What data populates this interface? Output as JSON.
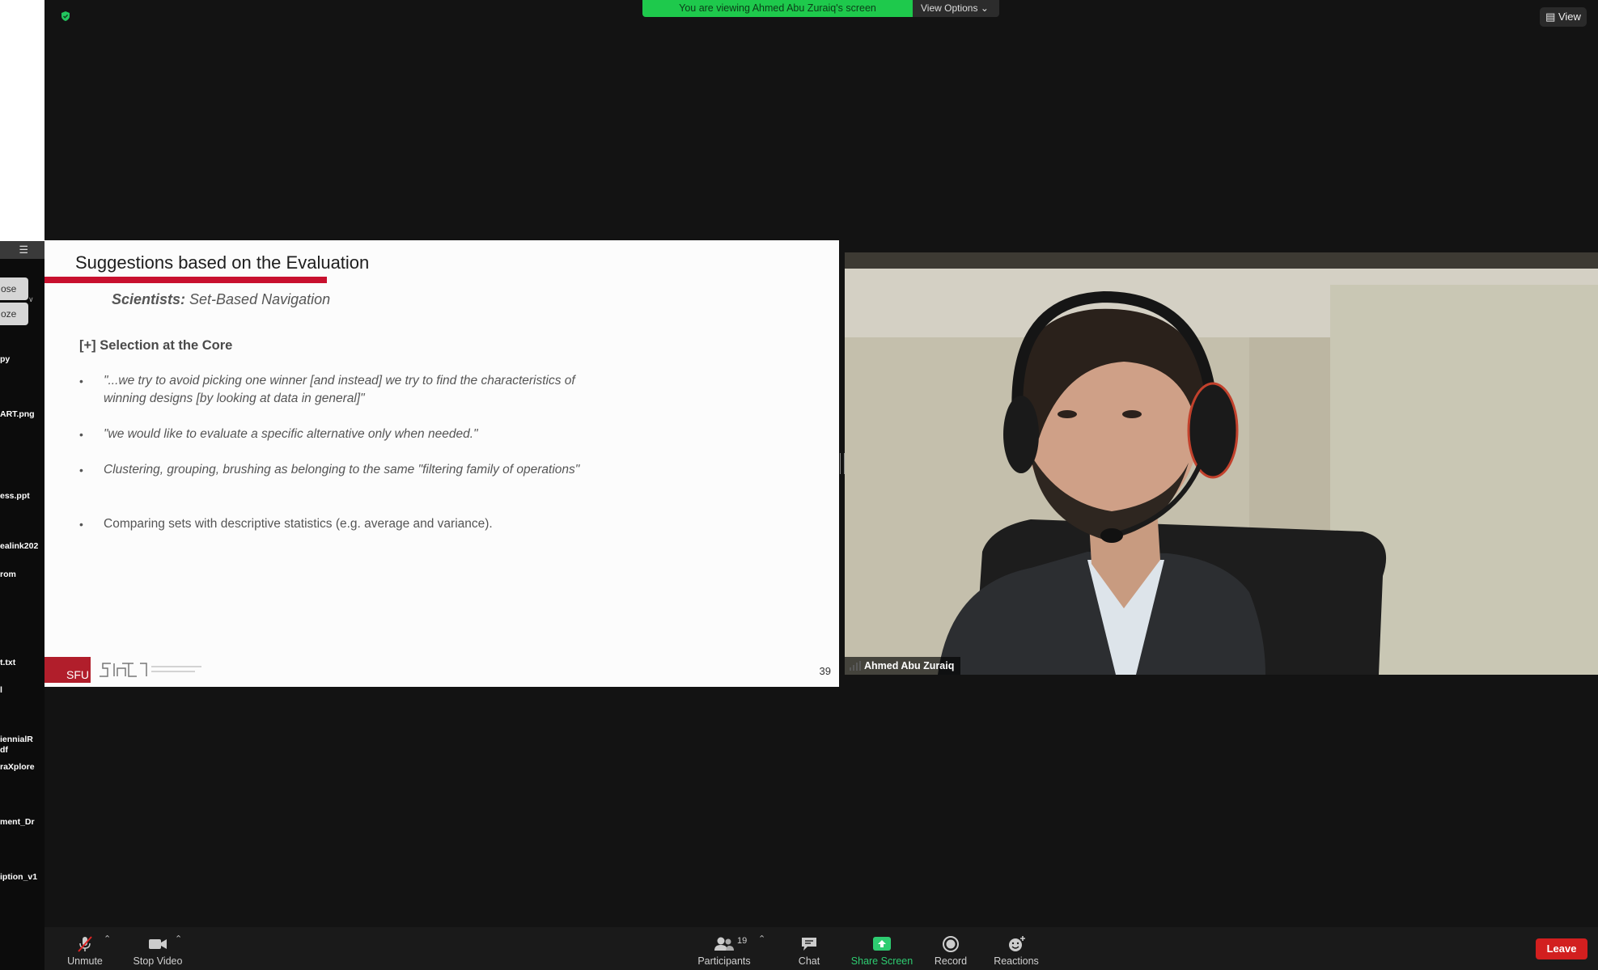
{
  "banner": {
    "text": "You are viewing Ahmed Abu Zuraiq's screen",
    "view_options": "View Options ⌄"
  },
  "top_right": {
    "view_label": "View"
  },
  "desktop": {
    "popup_items": [
      "ose",
      "oze"
    ],
    "files": [
      "py",
      "ART.png",
      "ess.ppt",
      "ealink202",
      "rom",
      "t.txt",
      "l",
      "iennialR\ndf",
      "raXplore",
      "ment_Dr",
      "iption_v1"
    ]
  },
  "slide": {
    "title": "Suggestions based on the Evaluation",
    "subtitle_bold": "Scientists:",
    "subtitle_rest": " Set-Based Navigation",
    "heading": "[+] Selection at the Core",
    "bullets": [
      "\"...we try to avoid picking one winner [and instead] we try to find the characteristics of winning designs [by looking at data in general]\"",
      "\"we would like to evaluate a specific alternative only when needed.\"",
      "Clustering, grouping, brushing as belonging to the same \"filtering family of operations\"",
      "Comparing sets with descriptive statistics (e.g. average and variance)."
    ],
    "logo_text": "SFU",
    "page_number": "39"
  },
  "video": {
    "participant_name": "Ahmed Abu Zuraiq"
  },
  "toolbar": {
    "unmute": "Unmute",
    "stop_video": "Stop Video",
    "participants": "Participants",
    "participants_count": "19",
    "chat": "Chat",
    "share_screen": "Share Screen",
    "record": "Record",
    "reactions": "Reactions",
    "leave": "Leave"
  },
  "colors": {
    "share_green": "#1ec94c",
    "leave_red": "#d21f1f",
    "slide_accent": "#c8102e"
  }
}
